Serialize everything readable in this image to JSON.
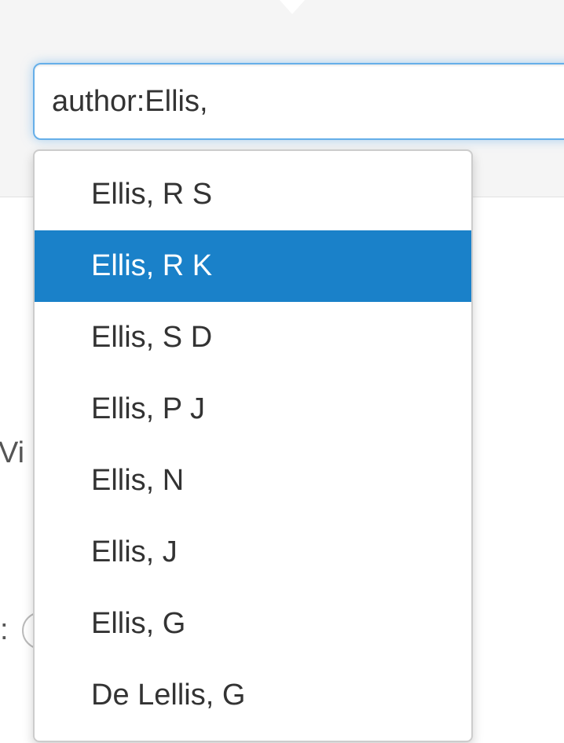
{
  "search": {
    "value": "author:Ellis,"
  },
  "background": {
    "partial_label": "Vi",
    "partial_colon": ":"
  },
  "suggestions": [
    {
      "label": "Ellis, R S",
      "active": false
    },
    {
      "label": "Ellis, R K",
      "active": true
    },
    {
      "label": "Ellis, S D",
      "active": false
    },
    {
      "label": "Ellis, P J",
      "active": false
    },
    {
      "label": "Ellis, N",
      "active": false
    },
    {
      "label": "Ellis, J",
      "active": false
    },
    {
      "label": "Ellis, G",
      "active": false
    },
    {
      "label": "De Lellis, G",
      "active": false
    }
  ],
  "colors": {
    "active_highlight": "#1a81c9",
    "focus_border": "#66afe9"
  }
}
